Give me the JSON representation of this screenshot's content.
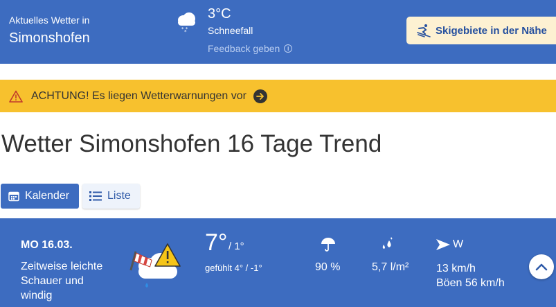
{
  "current": {
    "label": "Aktuelles Wetter in",
    "city": "Simonshofen",
    "temperature": "3°C",
    "condition": "Schneefall",
    "feedback": "Feedback geben"
  },
  "ski_button": {
    "label": "Skigebiete in der Nähe"
  },
  "warning": {
    "text": "ACHTUNG! Es liegen Wetterwarnungen vor"
  },
  "heading": "Wetter Simonshofen 16 Tage Trend",
  "view_toggle": {
    "calendar": "Kalender",
    "list": "Liste",
    "active": "calendar"
  },
  "day": {
    "date": "MO 16.03.",
    "description": "Zeitweise leichte Schauer und windig",
    "temp_max": "7°",
    "temp_min": "/ 1°",
    "felt": "gefühlt 4° / -1°",
    "rain_probability": "90 %",
    "rain_amount": "5,7 l/m²",
    "wind_direction": "W",
    "wind_speed": "13 km/h",
    "gusts": "Böen 56 km/h"
  },
  "colors": {
    "primary": "#3d6cc0",
    "warning": "#f7c12e",
    "ski_bg": "#fdf1d2",
    "alert": "#f5c518"
  }
}
